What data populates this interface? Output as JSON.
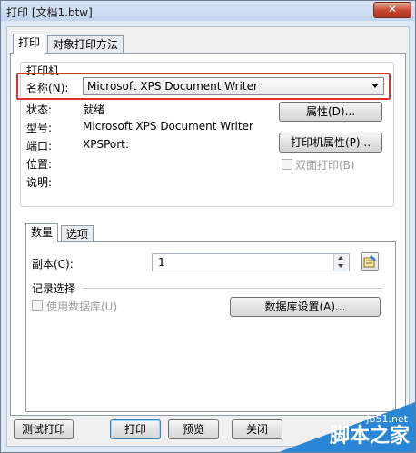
{
  "window": {
    "title": "打印 [文档1.btw]",
    "close_label": "✕"
  },
  "tabs": [
    {
      "label": "打印"
    },
    {
      "label": "对象打印方法"
    }
  ],
  "printer": {
    "group_label": "打印机",
    "name_label": "名称(N):",
    "name_value": "Microsoft XPS Document Writer",
    "status_label": "状态:",
    "status_value": "就绪",
    "type_label": "型号:",
    "type_value": "Microsoft XPS Document Writer",
    "port_label": "端口:",
    "port_value": "XPSPort:",
    "location_label": "位置:",
    "comment_label": "说明:",
    "properties_button": "属性(D)...",
    "printer_properties_button": "打印机属性(P)...",
    "duplex_label": "双面打印(B)"
  },
  "subtabs": [
    {
      "label": "数量"
    },
    {
      "label": "选项"
    }
  ],
  "quantity": {
    "copies_label": "副本(C):",
    "copies_value": "1",
    "record_group_label": "记录选择",
    "use_database_label": "使用数据库(U)",
    "database_settings_button": "数据库设置(A)..."
  },
  "footer": {
    "test_print_button": "测试打印",
    "print_button": "打印",
    "preview_button": "预览",
    "close_button": "关闭"
  },
  "watermark": {
    "site": "jb51.net",
    "brand": "脚本之家"
  }
}
